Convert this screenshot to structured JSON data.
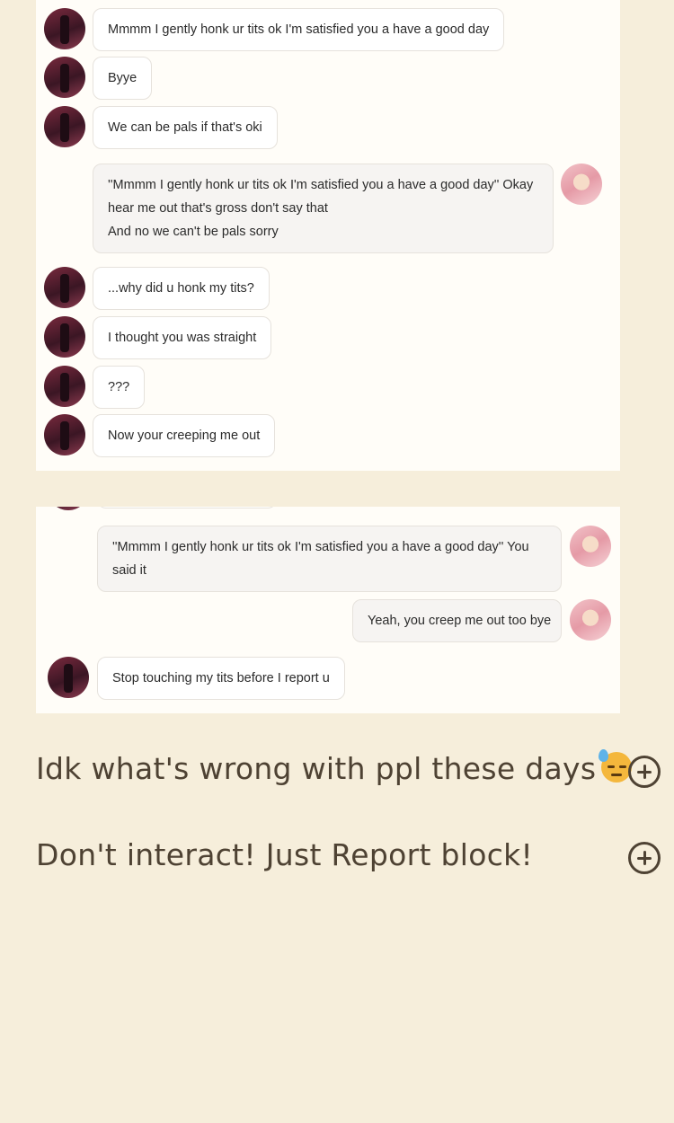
{
  "screenshot1": {
    "messages": [
      {
        "side": "left",
        "lines": [
          "Mmmm I gently honk ur tits ok I'm satisfied you a have a good day"
        ]
      },
      {
        "side": "left",
        "lines": [
          "Byye"
        ]
      },
      {
        "side": "left",
        "lines": [
          "We can be pals if that's oki"
        ]
      },
      {
        "side": "right",
        "lines": [
          "''Mmmm I gently honk ur tits ok I'm satisfied you a have a good day'' Okay",
          "hear me out that's gross don't say that",
          "And no we can't be pals sorry"
        ]
      },
      {
        "side": "left",
        "lines": [
          "...why did u honk my tits?"
        ]
      },
      {
        "side": "left",
        "lines": [
          "I thought you was straight"
        ]
      },
      {
        "side": "left",
        "lines": [
          "???"
        ]
      },
      {
        "side": "left",
        "lines": [
          "Now your creeping me out"
        ]
      }
    ]
  },
  "screenshot2": {
    "messages": [
      {
        "side": "right",
        "lines": [
          "''Mmmm I gently honk ur tits ok I'm satisfied you a have a good day'' You",
          "said it"
        ]
      },
      {
        "side": "right",
        "lines": [
          "Yeah, you creep me out too bye"
        ]
      },
      {
        "side": "left",
        "lines": [
          "Stop touching my tits before I report u"
        ]
      }
    ]
  },
  "sections": [
    {
      "title": "Idk what's wrong with ppl these days",
      "emoji": "downcast-face-with-sweat-emoji"
    },
    {
      "title": "Don't interact! Just Report block!"
    }
  ],
  "colors": {
    "page_bg": "#f6eedb",
    "card_bg": "#fffdf8",
    "heading": "#4e4233"
  }
}
